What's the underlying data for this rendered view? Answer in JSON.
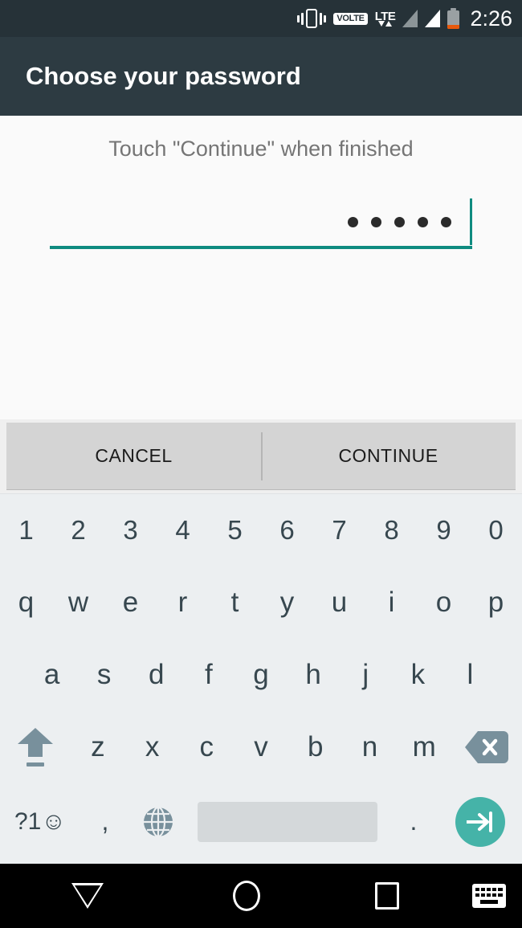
{
  "status_bar": {
    "icons": [
      "vibrate-icon",
      "volte-badge",
      "lte-icon",
      "signal-icon-dim",
      "signal-icon-full",
      "battery-icon"
    ],
    "volte_label": "VOLTE",
    "lte_label": "LTE",
    "time": "2:26",
    "background_color": "#263238"
  },
  "header": {
    "title": "Choose your password",
    "background_color": "#2d3b42"
  },
  "content": {
    "instruction": "Touch \"Continue\" when finished",
    "password_field": {
      "masked_char_count": 5,
      "value_mask": "•••••",
      "cursor_visible": true,
      "accent_color": "#0f8b80"
    }
  },
  "action_bar": {
    "cancel_label": "CANCEL",
    "continue_label": "CONTINUE",
    "background_color": "#d4d4d4"
  },
  "keyboard": {
    "background_color": "#eceff1",
    "key_color": "#37474f",
    "row_numbers": [
      "1",
      "2",
      "3",
      "4",
      "5",
      "6",
      "7",
      "8",
      "9",
      "0"
    ],
    "row_top": [
      "q",
      "w",
      "e",
      "r",
      "t",
      "y",
      "u",
      "i",
      "o",
      "p"
    ],
    "row_home": [
      "a",
      "s",
      "d",
      "f",
      "g",
      "h",
      "j",
      "k",
      "l"
    ],
    "row_bottom_letters": [
      "z",
      "x",
      "c",
      "v",
      "b",
      "n",
      "m"
    ],
    "shift_key": "shift-icon",
    "backspace_key": "backspace-icon",
    "symbols_label": "?1☺",
    "comma_label": ",",
    "globe_key": "globe-icon",
    "space_label": "",
    "period_label": ".",
    "enter_key": "enter-next-icon",
    "enter_color": "#45b3a8"
  },
  "nav_bar": {
    "back_label": "back-icon",
    "home_label": "home-icon",
    "recents_label": "recents-icon",
    "keyboard_label": "keyboard-icon",
    "background_color": "#000000"
  }
}
